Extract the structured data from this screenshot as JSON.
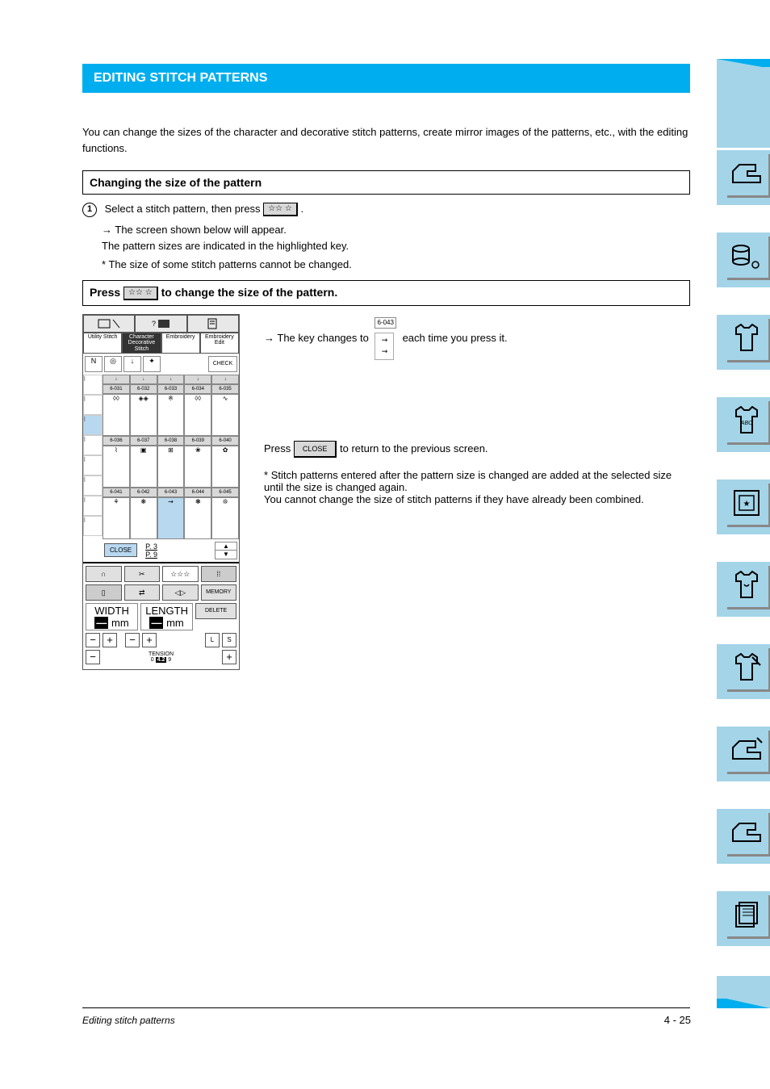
{
  "header": {
    "title": "EDITING STITCH PATTERNS"
  },
  "intro": "You can change the sizes of the character and decorative stitch patterns, create mirror images of the patterns, etc., with the editing functions.",
  "sections": {
    "sizing": {
      "title": "Changing the size of the pattern",
      "step1_a": "Select a stitch pattern, then press",
      "step1_b": ".",
      "arrow1": "The screen shown below will appear.\nThe pattern sizes are indicated in the highlighted key.",
      "note_prefix": "*",
      "note_text": "The size of some stitch patterns cannot be changed.",
      "press_prefix": "Press",
      "press_suffix": "to change the size of the pattern.",
      "arrow2_prefix": "The key changes to",
      "arrow2_sample_code": "6-043",
      "arrow2_mid": "each time you press it.",
      "press2_text_a": "Press",
      "press2_text_b": "to return to the previous screen.",
      "note2_text": "Stitch patterns entered after the pattern size is changed are added at the selected size until the size is changed again.\nYou cannot change the size of stitch patterns if they have already been combined."
    }
  },
  "close_label": "CLOSE",
  "screen": {
    "tabs": [
      "Utility Stitch",
      "Character Decorative Stitch",
      "Embroidery",
      "Embroidery Edit"
    ],
    "check": "CHECK",
    "headers_row1": [
      "6-031",
      "6-032",
      "6-033",
      "6-034",
      "6-035"
    ],
    "headers_row2": [
      "6-036",
      "6-037",
      "6-038",
      "6-039",
      "6-040"
    ],
    "headers_row3": [
      "6-041",
      "6-042",
      "6-043",
      "6-044",
      "6-045"
    ],
    "close": "CLOSE",
    "page": "P. 3\nP. 9",
    "memory": "MEMORY",
    "delete": "DELETE",
    "width": "WIDTH",
    "length": "LENGTH",
    "tension": "TENSION",
    "tension_val": "4.2",
    "mm": "mm",
    "ls": [
      "L",
      "S"
    ]
  },
  "footer": {
    "section": "Editing stitch patterns",
    "page": "4 - 25"
  }
}
